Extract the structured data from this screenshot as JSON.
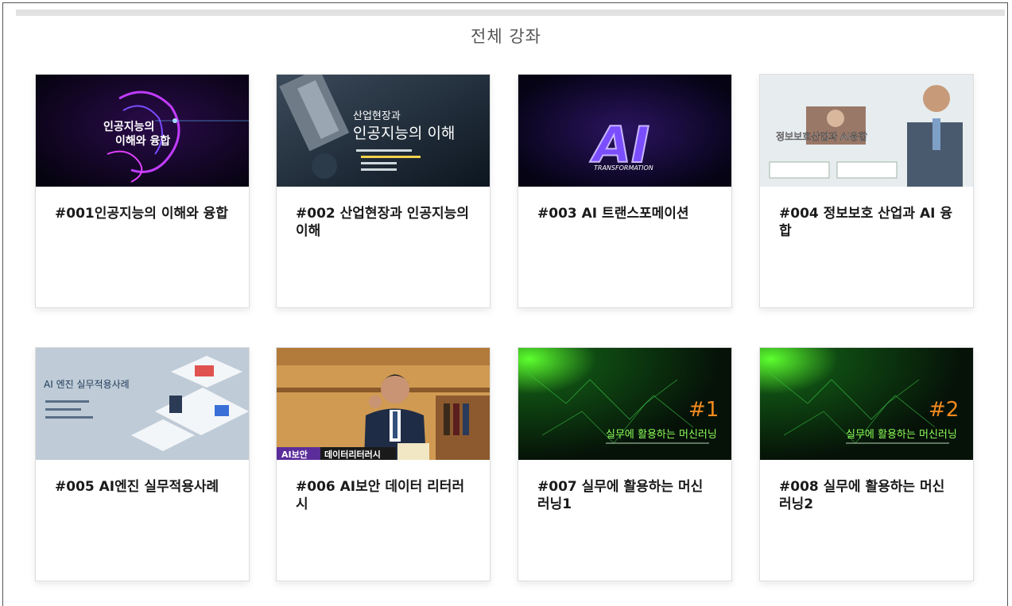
{
  "page": {
    "title": "전체 강좌"
  },
  "courses": [
    {
      "title": "#001인공지능의 이해와 융합",
      "thumb_text": [
        "인공지능의",
        "이해와 융합"
      ]
    },
    {
      "title": "#002 산업현장과 인공지능의 이해",
      "thumb_text": [
        "산업현장과",
        "인공지능의 이해"
      ]
    },
    {
      "title": "#003 AI 트랜스포메이션",
      "thumb_text": [
        "AI",
        "TRANSFORMATION"
      ]
    },
    {
      "title": "#004 정보보호 산업과 AI 융합",
      "thumb_text": [
        "정보보호산업과 AI융합"
      ]
    },
    {
      "title": "#005 AI엔진 실무적용사례",
      "thumb_text": [
        "AI 엔진 실무적용사례"
      ]
    },
    {
      "title": "#006 AI보안 데이터 리터러시",
      "thumb_text": [
        "AI보안",
        "데이터리터러시"
      ]
    },
    {
      "title": "#007 실무에 활용하는 머신러닝1",
      "thumb_text": [
        "#1",
        "실무에 활용하는 머신러닝"
      ]
    },
    {
      "title": "#008 실무에 활용하는 머신러닝2",
      "thumb_text": [
        "#2",
        "실무에 활용하는 머신러닝"
      ]
    }
  ],
  "colors": {
    "border": "#555555",
    "topbar": "#e2e2e2",
    "title": "#555555",
    "card_title": "#1a1a1a",
    "orange_accent": "#f28a1f"
  }
}
